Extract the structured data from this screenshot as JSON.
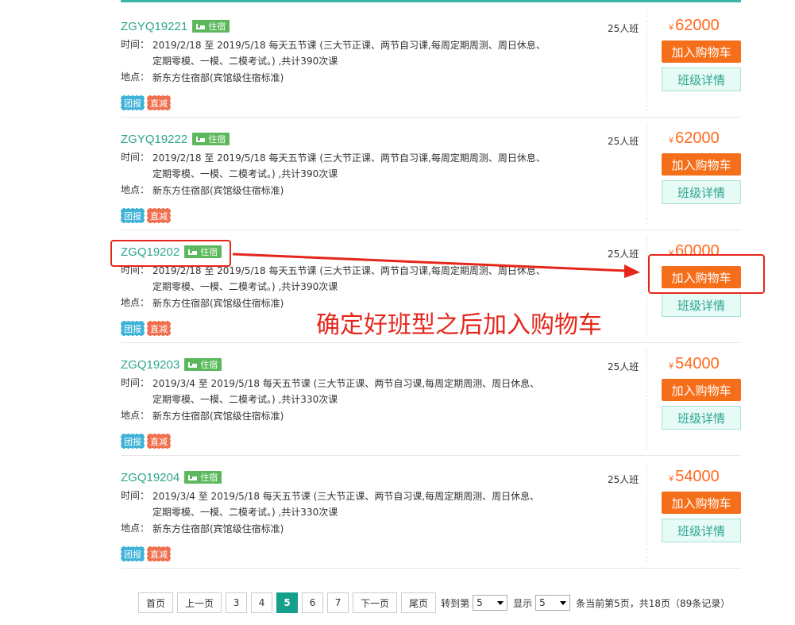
{
  "classes": [
    {
      "code": "ZGYQ19221",
      "badge": "住宿",
      "time_label": "时间：",
      "time": "2019/2/18 至 2019/5/18 每天五节课 (三大节正课、两节自习课,每周定期周测、周日休息、定期零模、一模、二模考试。) ,共计390次课",
      "place_label": "地点：",
      "place": "新东方住宿部(宾馆级住宿标准)",
      "tags": [
        "团报",
        "直减"
      ],
      "capacity": "25人班",
      "currency": "¥",
      "price": "62000",
      "cart": "加入购物车",
      "detail": "班级详情"
    },
    {
      "code": "ZGYQ19222",
      "badge": "住宿",
      "time_label": "时间：",
      "time": "2019/2/18 至 2019/5/18 每天五节课 (三大节正课、两节自习课,每周定期周测、周日休息、定期零模、一模、二模考试。) ,共计390次课",
      "place_label": "地点：",
      "place": "新东方住宿部(宾馆级住宿标准)",
      "tags": [
        "团报",
        "直减"
      ],
      "capacity": "25人班",
      "currency": "¥",
      "price": "62000",
      "cart": "加入购物车",
      "detail": "班级详情"
    },
    {
      "code": "ZGQ19202",
      "badge": "住宿",
      "time_label": "时间：",
      "time": "2019/2/18 至 2019/5/18 每天五节课 (三大节正课、两节自习课,每周定期周测、周日休息、定期零模、一模、二模考试。) ,共计390次课",
      "place_label": "地点：",
      "place": "新东方住宿部(宾馆级住宿标准)",
      "tags": [
        "团报",
        "直减"
      ],
      "capacity": "25人班",
      "currency": "¥",
      "price": "60000",
      "cart": "加入购物车",
      "detail": "班级详情"
    },
    {
      "code": "ZGQ19203",
      "badge": "住宿",
      "time_label": "时间：",
      "time": "2019/3/4 至 2019/5/18 每天五节课 (三大节正课、两节自习课,每周定期周测、周日休息、定期零模、一模、二模考试。) ,共计330次课",
      "place_label": "地点：",
      "place": "新东方住宿部(宾馆级住宿标准)",
      "tags": [
        "团报",
        "直减"
      ],
      "capacity": "25人班",
      "currency": "¥",
      "price": "54000",
      "cart": "加入购物车",
      "detail": "班级详情"
    },
    {
      "code": "ZGQ19204",
      "badge": "住宿",
      "time_label": "时间：",
      "time": "2019/3/4 至 2019/5/18 每天五节课 (三大节正课、两节自习课,每周定期周测、周日休息、定期零模、一模、二模考试。) ,共计330次课",
      "place_label": "地点：",
      "place": "新东方住宿部(宾馆级住宿标准)",
      "tags": [
        "团报",
        "直减"
      ],
      "capacity": "25人班",
      "currency": "¥",
      "price": "54000",
      "cart": "加入购物车",
      "detail": "班级详情"
    }
  ],
  "annotation": "确定好班型之后加入购物车",
  "colors": {
    "accent": "#2ea58f",
    "price": "#ff6a1f",
    "cart": "#f56e1a",
    "highlight": "#e5261b"
  },
  "pagination": {
    "first": "首页",
    "prev": "上一页",
    "pages": [
      "3",
      "4",
      "5",
      "6",
      "7"
    ],
    "current": "5",
    "next": "下一页",
    "last": "尾页",
    "goto_label": "转到第",
    "goto_value": "5",
    "show_label": "显示",
    "show_value": "5",
    "summary": "条当前第5页，共18页（89条记录）"
  }
}
